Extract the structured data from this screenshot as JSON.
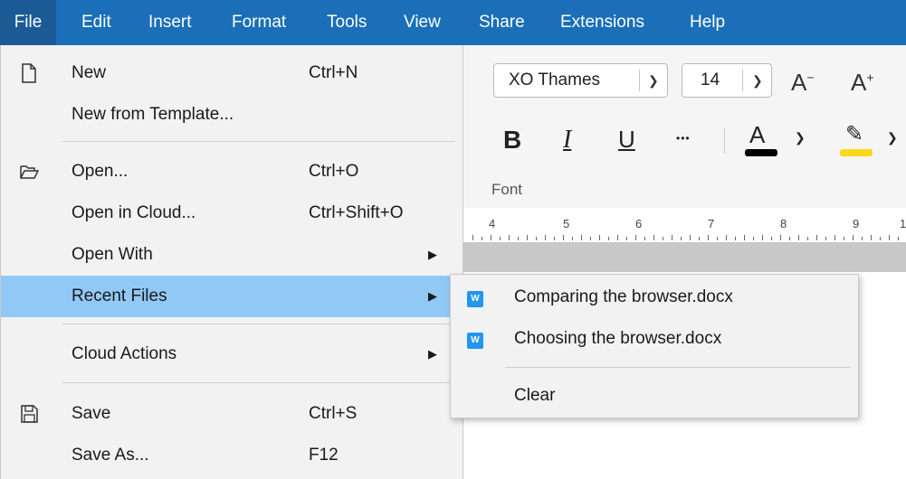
{
  "menubar": {
    "items": [
      "File",
      "Edit",
      "Insert",
      "Format",
      "Tools",
      "View",
      "Share",
      "Extensions",
      "Help"
    ]
  },
  "toolbar": {
    "font_name": "XO Thames",
    "font_size": "14",
    "group_label": "Font",
    "bold_glyph": "B",
    "italic_glyph": "I",
    "underline_glyph": "U",
    "more_glyph": "•••",
    "color_glyph": "A",
    "font_color": "#000000",
    "highlight_color": "#f9d71c"
  },
  "ruler": {
    "numbers": [
      "4",
      "5",
      "6",
      "7",
      "8",
      "9",
      "1"
    ]
  },
  "file_menu": {
    "items": [
      {
        "label": "New",
        "shortcut": "Ctrl+N"
      },
      {
        "label": "New from Template...",
        "shortcut": ""
      },
      {
        "label": "Open...",
        "shortcut": "Ctrl+O"
      },
      {
        "label": "Open in Cloud...",
        "shortcut": "Ctrl+Shift+O"
      },
      {
        "label": "Open With",
        "shortcut": ""
      },
      {
        "label": "Recent Files",
        "shortcut": ""
      },
      {
        "label": "Cloud Actions",
        "shortcut": ""
      },
      {
        "label": "Save",
        "shortcut": "Ctrl+S"
      },
      {
        "label": "Save As...",
        "shortcut": "F12"
      }
    ]
  },
  "recent_files": {
    "files": [
      {
        "name": "Comparing the browser.docx",
        "icon_letter": "W"
      },
      {
        "name": "Choosing the browser.docx",
        "icon_letter": "W"
      }
    ],
    "clear_label": "Clear"
  },
  "colors": {
    "menubar": "#1a6fb8",
    "highlight": "#91c8f5",
    "doc_icon": "#2196f3"
  }
}
